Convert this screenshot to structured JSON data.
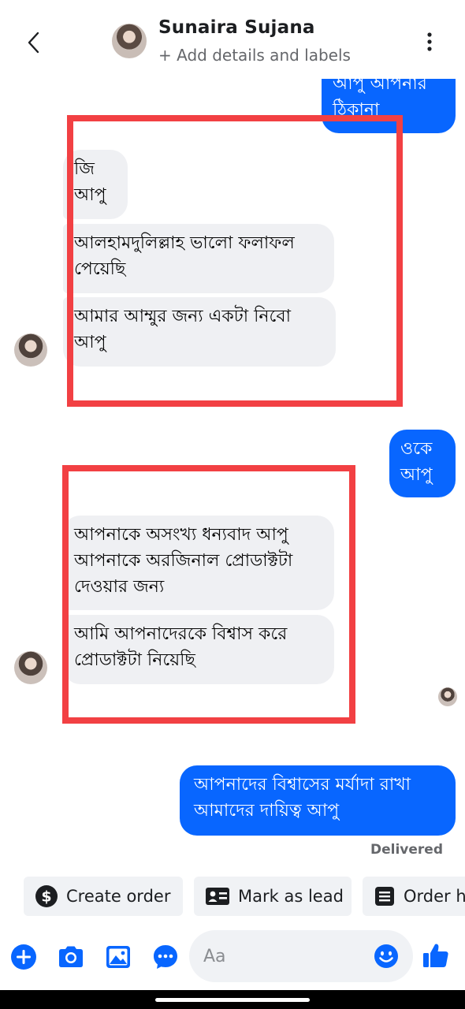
{
  "header": {
    "contact_name": "Sunaira Sujana",
    "subtitle": "+ Add details and labels",
    "icons": [
      "back-arrow-icon",
      "avatar",
      "more-vertical-icon"
    ]
  },
  "messages": {
    "out_1": "আপু আপনার\nঠিকানা",
    "in_1": "জি\nআপু",
    "in_2": "আলহামদুলিল্লাহ ভালো ফলাফল\nপেয়েছি",
    "in_3": "আমার আম্মুর জন্য একটা নিবো\nআপু",
    "out_2": "ওকে\nআপু",
    "in_4": "আপনাকে অসংখ্য ধন্যবাদ আপু\nআপনাকে অরজিনাল প্রোডাক্টটা\nদেওয়ার জন্য",
    "in_5": "আমি আপনাদেরকে বিশ্বাস করে\nপ্রোডাক্টটা নিয়েছি",
    "out_3": "আপনাদের বিশ্বাসের মর্যাদা রাখা\nআমাদের দায়িত্ব আপু",
    "status": "Delivered"
  },
  "actions": {
    "create_order": "Create order",
    "mark_as_lead": "Mark as lead",
    "order_history": "Order h"
  },
  "composer": {
    "placeholder": "Aa",
    "icons": [
      "plus-icon",
      "camera-icon",
      "gallery-icon",
      "chat-bubble-icon",
      "emoji-icon",
      "like-icon"
    ]
  },
  "colors": {
    "accent": "#0866ff",
    "incoming_bubble": "#eff0f3",
    "highlight_box": "#f24043",
    "chip_background": "#f0f2f5"
  }
}
